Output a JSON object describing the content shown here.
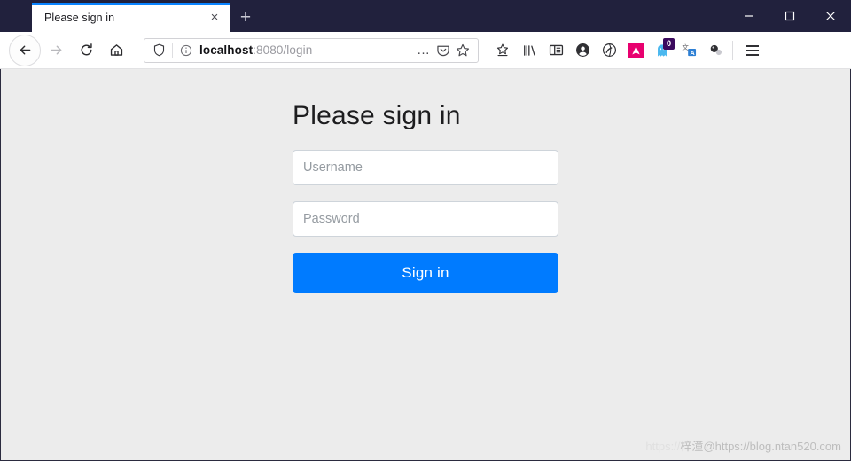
{
  "browser": {
    "tab": {
      "title": "Please sign in",
      "close_label": "×"
    },
    "new_tab_label": "+",
    "window_controls": {
      "minimize": "minimize-button",
      "maximize": "maximize-button",
      "close": "close-button"
    },
    "nav": {
      "back": "Back",
      "forward": "Forward",
      "reload": "Reload",
      "home": "Home"
    },
    "address_bar": {
      "url_host": "localhost",
      "url_rest": ":8080/login",
      "full_url": "localhost:8080/login",
      "page_actions_label": "…",
      "pocket_label": "Save to Pocket",
      "bookmark_label": "Bookmark this page"
    },
    "toolbar_items": [
      {
        "name": "pocket-star-icon",
        "label": "Save to Pocket"
      },
      {
        "name": "library-icon",
        "label": "Library"
      },
      {
        "name": "sidebar-icon",
        "label": "Sidebars"
      },
      {
        "name": "account-icon",
        "label": "Account"
      },
      {
        "name": "extension-circle-icon",
        "label": "Extension"
      },
      {
        "name": "extension-arrow-icon",
        "label": "Extension"
      },
      {
        "name": "extension-ghost-icon",
        "label": "Extension",
        "badge": "0"
      },
      {
        "name": "translate-icon",
        "label": "Translate"
      },
      {
        "name": "extension-molecule-icon",
        "label": "Extension"
      }
    ],
    "menu_label": "Open application menu"
  },
  "page": {
    "heading": "Please sign in",
    "username": {
      "placeholder": "Username",
      "value": ""
    },
    "password": {
      "placeholder": "Password",
      "value": ""
    },
    "submit_label": "Sign in",
    "watermark": {
      "faint_prefix": "https://",
      "text": "梓潼@https://blog.ntan520.com"
    }
  },
  "colors": {
    "titlebar": "#21213d",
    "tab_active_accent": "#0a84ff",
    "page_background": "#ececec",
    "primary_button": "#007bff",
    "input_border": "#ced4da",
    "extension_pink": "#e8006f",
    "badge_purple": "#3b0a5e"
  }
}
